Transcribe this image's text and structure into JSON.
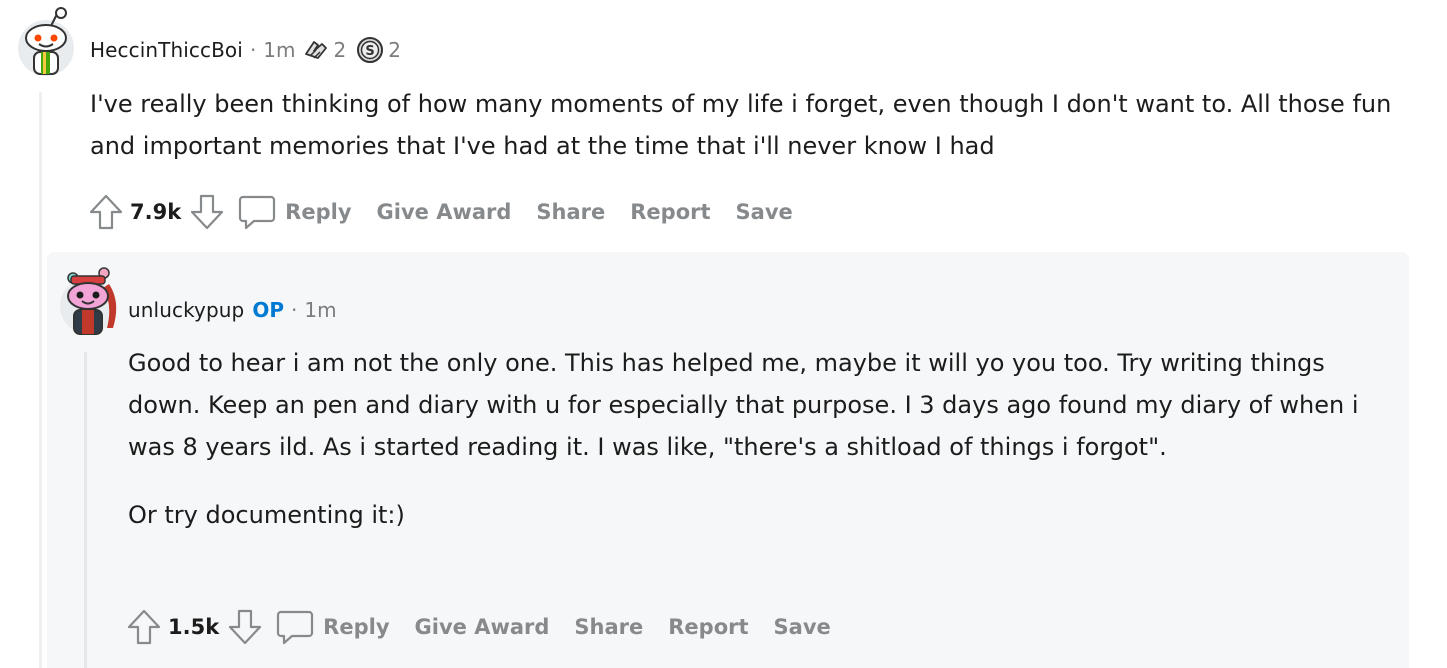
{
  "comment": {
    "author": "HeccinThiccBoi",
    "separator": "·",
    "time": "1m",
    "awards": [
      {
        "icon": "hands-award-icon",
        "count": "2"
      },
      {
        "icon": "silver-coin-award-icon",
        "count": "2"
      }
    ],
    "body": "I've really been thinking of how many moments of my life i forget, even though I don't want to. All those fun and important memories that I've had at the time that i'll never know I had",
    "score": "7.9k",
    "actions": {
      "reply": "Reply",
      "give_award": "Give Award",
      "share": "Share",
      "report": "Report",
      "save": "Save"
    }
  },
  "reply": {
    "author": "unluckypup",
    "op_badge": "OP",
    "separator": "·",
    "time": "1m",
    "paragraphs": [
      "Good to hear i am not the only one. This has helped me, maybe it will yo you too. Try writing things down. Keep an pen and diary with u for especially that purpose. I 3 days ago found my diary of when i was 8 years ild. As i started reading it. I was like, \"there's a shitload of things i forgot\".",
      "Or try documenting it:)"
    ],
    "score": "1.5k",
    "actions": {
      "reply": "Reply",
      "give_award": "Give Award",
      "share": "Share",
      "report": "Report",
      "save": "Save"
    }
  },
  "colors": {
    "op_badge": "#0079d3",
    "meta_text": "#7c7c7c",
    "action_text": "#878a8c",
    "reply_background": "#f6f7f8"
  }
}
